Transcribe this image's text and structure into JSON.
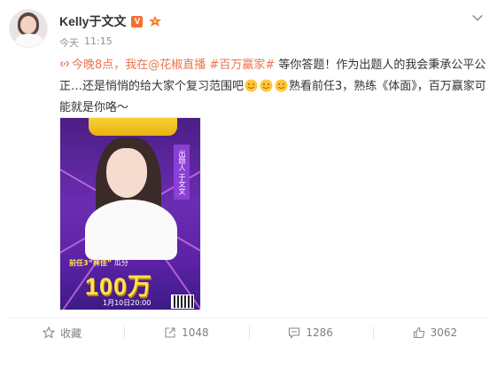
{
  "post": {
    "username": "Kelly于文文",
    "verified_badge": "V",
    "time": "今天",
    "clock": "11:15",
    "content": {
      "link_text": "今晚8点，我在@花椒直播",
      "hashtag": "#百万赢家#",
      "text_part1": " 等你答题！作为出题人的我会秉承公平公正…还是悄悄的给大家个复习范围吧",
      "text_part2": "熟看前任3，熟练《体面》，百万赢家可能就是你咯～"
    },
    "image": {
      "line1_highlight": "前任3“林佳”",
      "line1_rest": "瓜分",
      "amount": "100万",
      "date": "1月10日20:00",
      "tag": "出题人 于文文"
    },
    "actions": {
      "favorite": "收藏",
      "repost": "1048",
      "comment": "1286",
      "like": "3062"
    }
  },
  "colors": {
    "link": "#eb7350",
    "text": "#333333",
    "muted": "#939393",
    "poster_purple": "#6a2db2",
    "poster_yellow": "#ffe34f"
  },
  "icons": [
    "link-icon",
    "level-icon",
    "chevron-down-icon",
    "emoji-icon",
    "star-icon",
    "repost-icon",
    "comment-icon",
    "like-icon"
  ]
}
